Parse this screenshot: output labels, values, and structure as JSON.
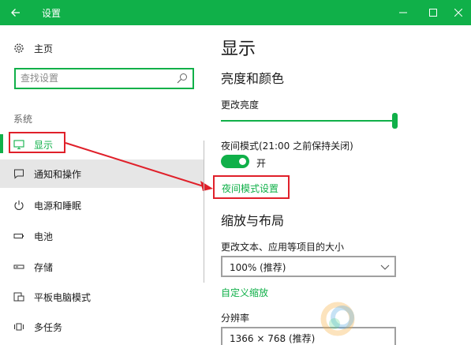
{
  "titlebar": {
    "title": "设置",
    "bg_color": "#10b049"
  },
  "sidebar": {
    "home_label": "主页",
    "search_placeholder": "查找设置",
    "section_label": "系统",
    "items": [
      {
        "label": "显示",
        "icon": "monitor-icon"
      },
      {
        "label": "通知和操作",
        "icon": "notification-icon"
      },
      {
        "label": "电源和睡眠",
        "icon": "power-icon"
      },
      {
        "label": "电池",
        "icon": "battery-icon"
      },
      {
        "label": "存储",
        "icon": "storage-icon"
      },
      {
        "label": "平板电脑模式",
        "icon": "tablet-icon"
      },
      {
        "label": "多任务",
        "icon": "multitask-icon"
      }
    ]
  },
  "main": {
    "title": "显示",
    "section_brightness": "亮度和颜色",
    "brightness_label": "更改亮度",
    "brightness_level": 1.0,
    "night_mode_label": "夜间模式(21:00 之前保持关闭)",
    "night_mode_state": "开",
    "night_mode_on": true,
    "night_mode_settings_link": "夜间模式设置",
    "section_scale": "缩放与布局",
    "scale_label": "更改文本、应用等项目的大小",
    "scale_value": "100% (推荐)",
    "custom_scale_link": "自定义缩放",
    "resolution_label": "分辨率",
    "resolution_value": "1366 × 768 (推荐)"
  },
  "colors": {
    "accent": "#10b049",
    "annotation": "#e0202a"
  }
}
